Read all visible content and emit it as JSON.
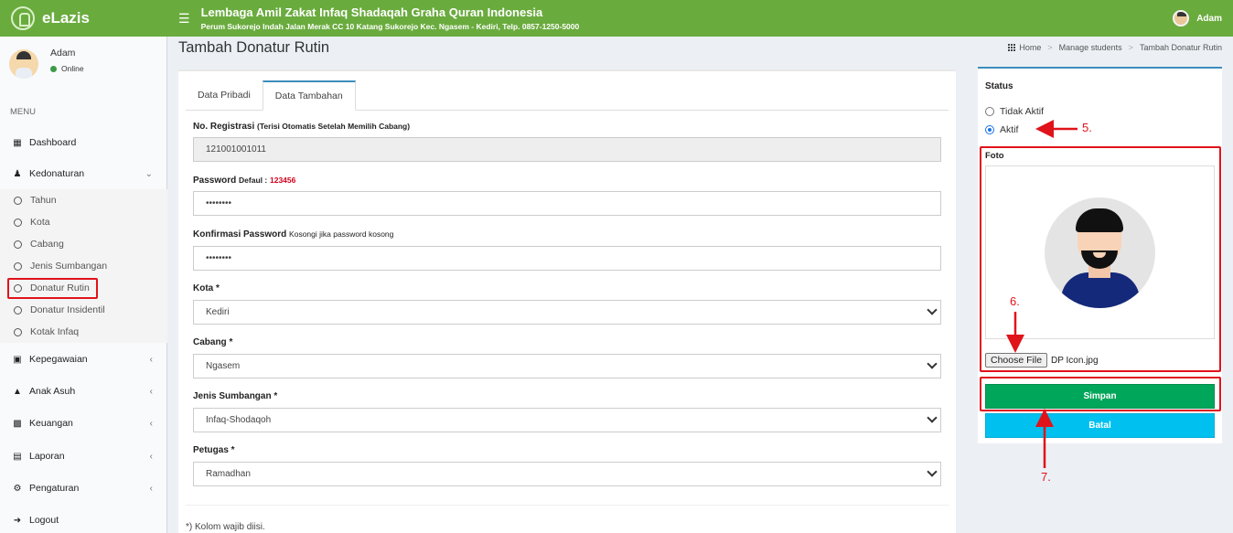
{
  "header": {
    "brand": "eLazis",
    "title": "Lembaga Amil Zakat Infaq Shadaqah Graha Quran Indonesia",
    "address": "Perum Sukorejo Indah Jalan Merak CC 10 Katang Sukorejo Kec. Ngasem - Kediri, Telp. 0857-1250-5000",
    "user": "Adam"
  },
  "sidebar": {
    "user": {
      "name": "Adam",
      "status": "Online"
    },
    "menu_header": "MENU",
    "items": {
      "dashboard": "Dashboard",
      "kedonaturan": "Kedonaturan",
      "kepegawaian": "Kepegawaian",
      "anak_asuh": "Anak Asuh",
      "keuangan": "Keuangan",
      "laporan": "Laporan",
      "pengaturan": "Pengaturan",
      "logout": "Logout"
    },
    "subitems": [
      "Tahun",
      "Kota",
      "Cabang",
      "Jenis Sumbangan",
      "Donatur Rutin",
      "Donatur Insidentil",
      "Kotak Infaq"
    ]
  },
  "page": {
    "title": "Tambah Donatur Rutin",
    "breadcrumb": [
      "Home",
      "Manage students",
      "Tambah Donatur Rutin"
    ]
  },
  "tabs": [
    "Data Pribadi",
    "Data Tambahan"
  ],
  "form": {
    "no_registrasi": {
      "label": "No. Registrasi",
      "hint": "(Terisi Otomatis Setelah Memilih Cabang)",
      "value": "121001001011"
    },
    "password": {
      "label": "Password",
      "hint": "Defaul :",
      "default_value": "123456",
      "value": "••••••••"
    },
    "konfirmasi": {
      "label": "Konfirmasi Password",
      "hint": "Kosongi jika password kosong",
      "value": "••••••••"
    },
    "kota": {
      "label": "Kota *",
      "value": "Kediri"
    },
    "cabang": {
      "label": "Cabang *",
      "value": "Ngasem"
    },
    "jenis": {
      "label": "Jenis Sumbangan *",
      "value": "Infaq-Shodaqoh"
    },
    "petugas": {
      "label": "Petugas *",
      "value": "Ramadhan"
    },
    "footnote": "*) Kolom wajib diisi."
  },
  "side": {
    "status_label": "Status",
    "options": [
      "Tidak Aktif",
      "Aktif"
    ],
    "selected": "Aktif",
    "foto_label": "Foto",
    "choose_file": "Choose File",
    "file_name": "DP Icon.jpg",
    "save": "Simpan",
    "cancel": "Batal"
  },
  "annotations": [
    "5.",
    "6.",
    "7."
  ],
  "colors": {
    "header": "#6aab3e",
    "accent_red": "#e0131a",
    "save": "#00a65a",
    "cancel": "#00c0ef",
    "tab_active": "#3c8dbc"
  }
}
